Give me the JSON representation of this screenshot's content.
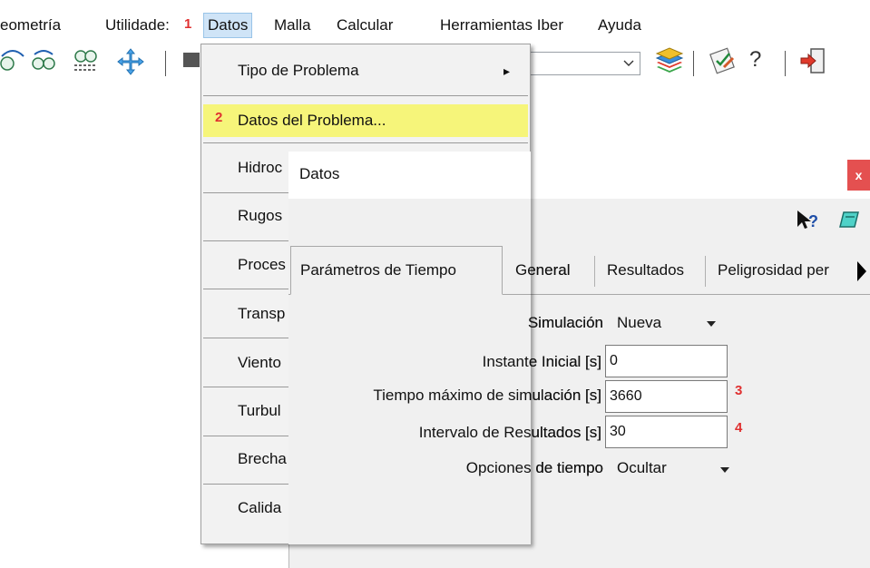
{
  "menubar": {
    "items": [
      {
        "label": "eometría"
      },
      {
        "label": "Utilidade:"
      },
      {
        "label": "Datos"
      },
      {
        "label": "Malla"
      },
      {
        "label": "Calcular"
      },
      {
        "label": "Herramientas Iber"
      },
      {
        "label": "Ayuda"
      }
    ],
    "marker": "1"
  },
  "dropdown": {
    "items": [
      {
        "label": "Tipo de Problema",
        "submenu": "▸"
      },
      {
        "label": "Datos del Problema...",
        "marker": "2"
      },
      {
        "label": "Hidroc"
      },
      {
        "label": "Rugos"
      },
      {
        "label": "Proces"
      },
      {
        "label": "Transp"
      },
      {
        "label": "Viento"
      },
      {
        "label": "Turbul"
      },
      {
        "label": "Brecha"
      },
      {
        "label": "Calida"
      }
    ]
  },
  "dialog": {
    "title": "Datos",
    "close_label": "x",
    "tabs": [
      {
        "label": "Parámetros de Tiempo"
      },
      {
        "label": "General"
      },
      {
        "label": "Resultados"
      },
      {
        "label": "Peligrosidad per"
      }
    ],
    "fields": {
      "simulacion": {
        "label": "Simulación",
        "value": "Nueva"
      },
      "instante_inicial": {
        "label": "Instante Inicial [s]",
        "value": "0"
      },
      "tiempo_maximo": {
        "label": "Tiempo máximo de simulación [s]",
        "value": "3660",
        "marker": "3"
      },
      "intervalo": {
        "label": "Intervalo de Resultados [s]",
        "value": "30",
        "marker": "4"
      },
      "opciones_tiempo": {
        "label": "Opciones de tiempo",
        "value": "Ocultar"
      }
    }
  },
  "colors": {
    "highlight": "#f6f57a",
    "marker": "#e03030",
    "close": "#e45050"
  }
}
